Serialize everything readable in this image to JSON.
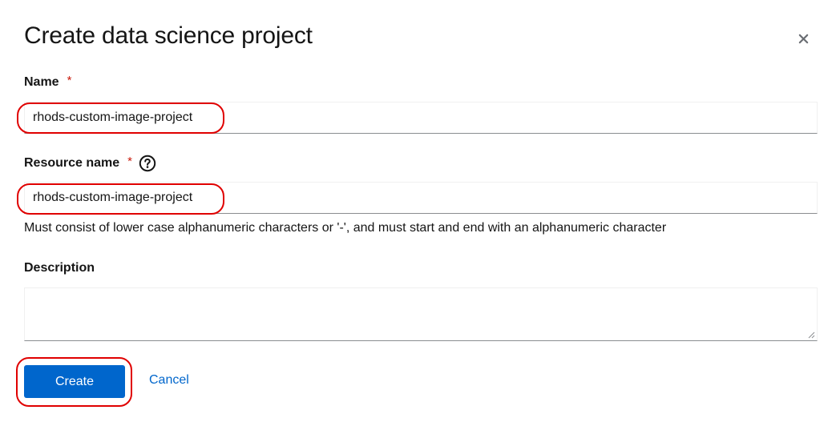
{
  "dialog": {
    "title": "Create data science project",
    "close_icon": "close-icon"
  },
  "fields": {
    "name": {
      "label": "Name",
      "required_marker": "*",
      "value": "rhods-custom-image-project"
    },
    "resource_name": {
      "label": "Resource name",
      "required_marker": "*",
      "help_icon": "question-circle-icon",
      "value": "rhods-custom-image-project",
      "helper_text": "Must consist of lower case alphanumeric characters or '-', and must start and end with an alphanumeric character"
    },
    "description": {
      "label": "Description",
      "value": ""
    }
  },
  "actions": {
    "create_label": "Create",
    "cancel_label": "Cancel"
  },
  "colors": {
    "primary": "#0066cc",
    "required": "#c9190b",
    "annotation": "#e00000"
  }
}
